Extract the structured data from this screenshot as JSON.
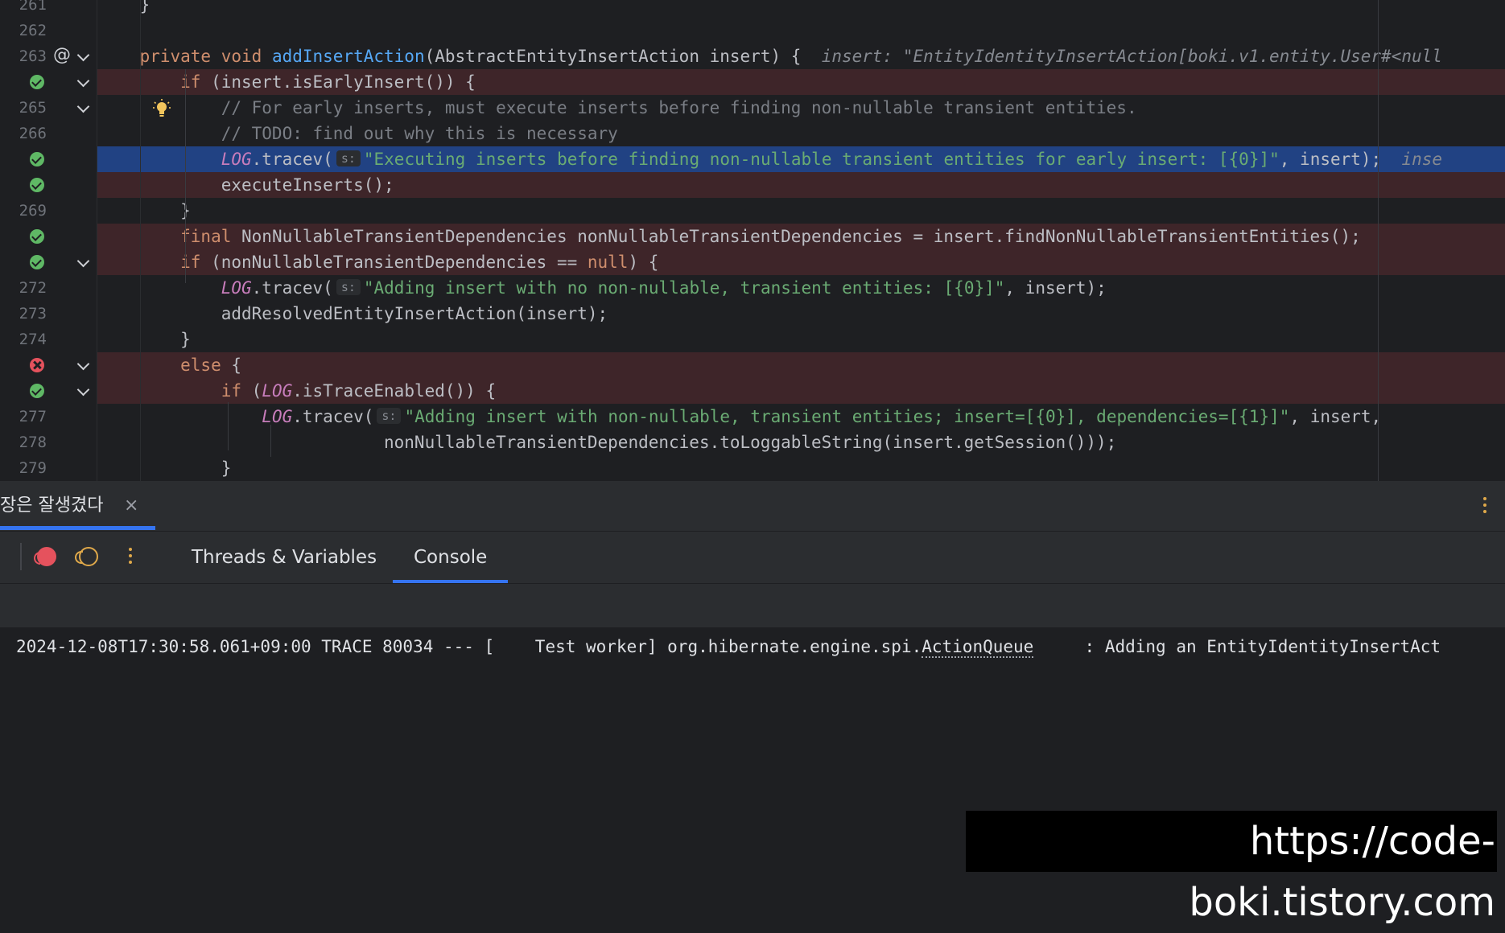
{
  "editor": {
    "lines": [
      {
        "num": "261",
        "marker": "none",
        "fold": false,
        "highlight": "none",
        "indent": 0,
        "tokens": [
          {
            "t": "    }",
            "c": "plain"
          }
        ]
      },
      {
        "num": "262",
        "marker": "none",
        "fold": false,
        "highlight": "none",
        "indent": 0,
        "tokens": []
      },
      {
        "num": "263",
        "marker": "at",
        "fold": true,
        "highlight": "none",
        "indent": 0,
        "tokens": [
          {
            "t": "    private void ",
            "c": "kw"
          },
          {
            "t": "addInsertAction",
            "c": "fn"
          },
          {
            "t": "(AbstractEntityInsertAction insert) {  ",
            "c": "plain"
          },
          {
            "t": "insert: \"EntityIdentityInsertAction[boki.v1.entity.User#<null",
            "c": "inlay"
          }
        ]
      },
      {
        "num": "",
        "marker": "ok",
        "fold": true,
        "highlight": "bp",
        "indent": 0,
        "tokens": [
          {
            "t": "        if ",
            "c": "kw"
          },
          {
            "t": "(insert.isEarlyInsert()) {",
            "c": "plain"
          }
        ]
      },
      {
        "num": "265",
        "marker": "none",
        "fold": true,
        "highlight": "none",
        "indent": 0,
        "bulb": true,
        "tokens": [
          {
            "t": "            // For early inserts, must execute inserts before finding non-nullable transient entities.",
            "c": "cmt"
          }
        ]
      },
      {
        "num": "266",
        "marker": "none",
        "fold": false,
        "highlight": "none",
        "indent": 0,
        "tokens": [
          {
            "t": "            // TODO: find out why this is necessary",
            "c": "cmt"
          }
        ]
      },
      {
        "num": "",
        "marker": "ok",
        "fold": false,
        "highlight": "exec",
        "indent": 0,
        "tokens": [
          {
            "t": "            ",
            "c": "plain"
          },
          {
            "t": "LOG",
            "c": "log"
          },
          {
            "t": ".tracev(",
            "c": "plain"
          },
          {
            "t": "s:",
            "c": "hint"
          },
          {
            "t": "\"Executing inserts before finding non-nullable transient entities for early insert: [{0}]\"",
            "c": "str"
          },
          {
            "t": ", insert);  ",
            "c": "plain"
          },
          {
            "t": "inse",
            "c": "inlay"
          }
        ]
      },
      {
        "num": "",
        "marker": "ok",
        "fold": false,
        "highlight": "bp",
        "indent": 0,
        "tokens": [
          {
            "t": "            executeInserts();",
            "c": "plain"
          }
        ]
      },
      {
        "num": "269",
        "marker": "none",
        "fold": false,
        "highlight": "none",
        "indent": 0,
        "tokens": [
          {
            "t": "        }",
            "c": "plain"
          }
        ]
      },
      {
        "num": "",
        "marker": "ok",
        "fold": false,
        "highlight": "bp",
        "indent": 0,
        "tokens": [
          {
            "t": "        final ",
            "c": "kw"
          },
          {
            "t": "NonNullableTransientDependencies nonNullableTransientDependencies = insert.findNonNullableTransientEntities();",
            "c": "plain"
          }
        ]
      },
      {
        "num": "",
        "marker": "ok",
        "fold": true,
        "highlight": "bp",
        "indent": 0,
        "tokens": [
          {
            "t": "        if ",
            "c": "kw"
          },
          {
            "t": "(nonNullableTransientDependencies == ",
            "c": "plain"
          },
          {
            "t": "null",
            "c": "kw"
          },
          {
            "t": ") {",
            "c": "plain"
          }
        ]
      },
      {
        "num": "272",
        "marker": "none",
        "fold": false,
        "highlight": "none",
        "indent": 0,
        "tokens": [
          {
            "t": "            ",
            "c": "plain"
          },
          {
            "t": "LOG",
            "c": "log"
          },
          {
            "t": ".tracev(",
            "c": "plain"
          },
          {
            "t": "s:",
            "c": "hint"
          },
          {
            "t": "\"Adding insert with no non-nullable, transient entities: [{0}]\"",
            "c": "str"
          },
          {
            "t": ", insert);",
            "c": "plain"
          }
        ]
      },
      {
        "num": "273",
        "marker": "none",
        "fold": false,
        "highlight": "none",
        "indent": 0,
        "tokens": [
          {
            "t": "            addResolvedEntityInsertAction(insert);",
            "c": "plain"
          }
        ]
      },
      {
        "num": "274",
        "marker": "none",
        "fold": false,
        "highlight": "none",
        "indent": 0,
        "tokens": [
          {
            "t": "        }",
            "c": "plain"
          }
        ]
      },
      {
        "num": "",
        "marker": "err",
        "fold": true,
        "highlight": "bp",
        "indent": 0,
        "tokens": [
          {
            "t": "        else ",
            "c": "kw"
          },
          {
            "t": "{",
            "c": "plain"
          }
        ]
      },
      {
        "num": "",
        "marker": "ok",
        "fold": true,
        "highlight": "bp",
        "indent": 0,
        "tokens": [
          {
            "t": "            if ",
            "c": "kw"
          },
          {
            "t": "(",
            "c": "plain"
          },
          {
            "t": "LOG",
            "c": "log"
          },
          {
            "t": ".isTraceEnabled()) {",
            "c": "plain"
          }
        ]
      },
      {
        "num": "277",
        "marker": "none",
        "fold": false,
        "highlight": "none",
        "indent": 0,
        "tokens": [
          {
            "t": "                ",
            "c": "plain"
          },
          {
            "t": "LOG",
            "c": "log"
          },
          {
            "t": ".tracev(",
            "c": "plain"
          },
          {
            "t": "s:",
            "c": "hint"
          },
          {
            "t": "\"Adding insert with non-nullable, transient entities; insert=[{0}], dependencies=[{1}]\"",
            "c": "str"
          },
          {
            "t": ", insert,",
            "c": "plain"
          }
        ]
      },
      {
        "num": "278",
        "marker": "none",
        "fold": false,
        "highlight": "none",
        "indent": 0,
        "tokens": [
          {
            "t": "                            nonNullableTransientDependencies.toLoggableString(insert.getSession()));",
            "c": "plain"
          }
        ]
      },
      {
        "num": "279",
        "marker": "none",
        "fold": false,
        "highlight": "none",
        "indent": 0,
        "tokens": [
          {
            "t": "            }",
            "c": "plain"
          }
        ]
      }
    ]
  },
  "panel": {
    "session_tab": "장은 잘생겼다",
    "close_icon": "×"
  },
  "toolbar": {
    "tabs": [
      {
        "label": "Threads & Variables",
        "active": false
      },
      {
        "label": "Console",
        "active": true
      }
    ]
  },
  "console": {
    "line_prefix": "2024-12-08T17:30:58.061+09:00 TRACE 80034 --- [    Test worker] org.hibernate.engine.spi.",
    "line_link": "ActionQueue",
    "line_suffix": "     : Adding an EntityIdentityInsertAct"
  },
  "watermark": "https://code-boki.tistory.com",
  "colors": {
    "breakpoint_line": "#3e2529",
    "execution_line": "#214283",
    "accent": "#3574f0"
  },
  "icons": {
    "verified_breakpoint": "check-circle-icon",
    "invalid_breakpoint": "x-circle-icon",
    "annotation": "at-icon",
    "fold": "chevron-down-icon",
    "intention": "lightbulb-icon",
    "record": "record-icon",
    "mute": "mute-breakpoints-icon",
    "more": "kebab-icon"
  }
}
